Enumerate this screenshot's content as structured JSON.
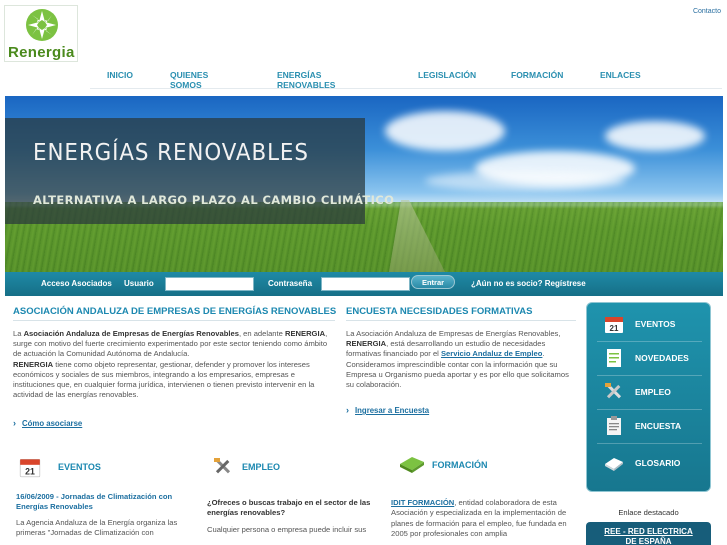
{
  "header": {
    "logo_text": "Renergia",
    "contact": "Contacto"
  },
  "nav": {
    "items": [
      "INICIO",
      "QUIENES SOMOS",
      "ENERGÍAS RENOVABLES",
      "LEGISLACIÓN",
      "FORMACIÓN",
      "ENLACES"
    ]
  },
  "hero": {
    "title": "ENERGÍAS RENOVABLES",
    "subtitle": "ALTERNATIVA A LARGO PLAZO AL CAMBIO CLIMÁTICO"
  },
  "login": {
    "label": "Acceso Asociados",
    "user_label": "Usuario",
    "password_label": "Contraseña",
    "submit": "Entrar",
    "register": "¿Aún no es socio? Regístrese"
  },
  "association": {
    "title": "ASOCIACIÓN ANDALUZA DE EMPRESAS DE ENERGÍAS RENOVABLES",
    "p1_prefix": "La ",
    "p1_bold": "Asociación Andaluza de Empresas de Energías Renovables",
    "p1_mid": ", en adelante ",
    "p1_bold2": "RENERGIA",
    "p1_rest": ", surge con motivo del fuerte crecimiento experimentado por este sector teniendo como ámbito de actuación la Comunidad Autónoma de Andalucía.",
    "p2_bold": "RENERGIA",
    "p2_rest": " tiene como objeto representar, gestionar, defender y promover los intereses económicos y sociales de sus miembros, integrando a los empresarios, empresas e instituciones que, en cualquier forma jurídica, intervienen o tienen previsto intervenir en la actividad de las energías renovables.",
    "link": "Cómo asociarse"
  },
  "survey": {
    "title": "ENCUESTA NECESIDADES FORMATIVAS",
    "t1": "La Asociación Andaluza de Empresas de Energías Renovables, ",
    "t_bold": "RENERGIA",
    "t2": ", está desarrollando un estudio de necesidades formativas financiado por el ",
    "t_link": "Servicio Andaluz de Empleo",
    "t3": ". Consideramos imprescindible contar con la información que su Empresa u Organismo pueda aportar y es por ello que solicitamos su colaboración.",
    "link": "Ingresar a Encuesta"
  },
  "sidebar": {
    "items": [
      "EVENTOS",
      "NOVEDADES",
      "EMPLEO",
      "ENCUESTA",
      "GLOSARIO"
    ],
    "featured_label": "Enlace destacado",
    "featured_line1": "REE - RED ELECTRICA",
    "featured_line2": "DE ESPAÑA"
  },
  "events": {
    "title": "EVENTOS",
    "headline": "16/06/2009 - Jornadas de Climatización con Energías Renovables",
    "text": "La Agencia Andaluza de la Energía organiza las primeras \"Jornadas de Climatización con"
  },
  "jobs": {
    "title": "EMPLEO",
    "question": "¿Ofreces o buscas trabajo en el sector de las energías renovables?",
    "text": "Cualquier persona o empresa puede incluir sus"
  },
  "training": {
    "title": "FORMACIÓN",
    "link": "IDIT FORMACIÓN",
    "text": ", entidad colaboradora de esta Asociación y especializada en la implementación de planes de formación para el empleo, fue fundada en 2005 por profesionales con amplia"
  },
  "colors": {
    "accent": "#1c88b0",
    "nav": "#2a8fb0",
    "bar": "#1f8aa6"
  }
}
